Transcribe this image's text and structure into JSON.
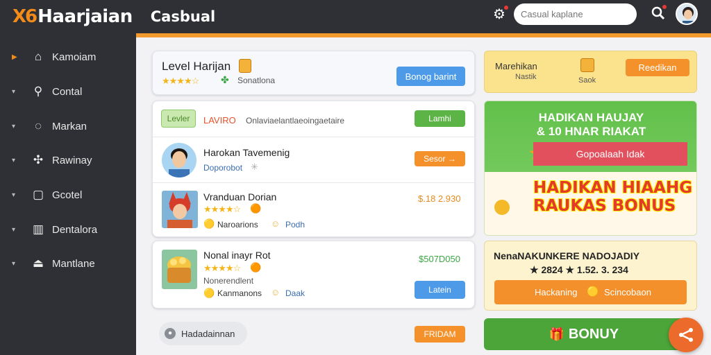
{
  "header": {
    "brand_mark": "X6",
    "brand_name": "Haarjaian",
    "app_title": "Casbual",
    "search_placeholder": "Casual kaplane"
  },
  "sidebar": {
    "items": [
      {
        "label": "Kamoiam",
        "icon": "home-icon"
      },
      {
        "label": "Contal",
        "icon": "search-icon"
      },
      {
        "label": "Markan",
        "icon": "chat-icon"
      },
      {
        "label": "Rawinay",
        "icon": "puzzle-icon"
      },
      {
        "label": "Gcotel",
        "icon": "box-icon"
      },
      {
        "label": "Dentalora",
        "icon": "building-icon"
      },
      {
        "label": "Mantlane",
        "icon": "upload-icon"
      }
    ]
  },
  "level": {
    "title": "Level Harijan",
    "rating_stars": 4.5,
    "subtitle": "Sonatlona",
    "button": "Bonog barint"
  },
  "list": {
    "header": {
      "tag": "Levler",
      "title": "LAVIRO",
      "subtitle": "Onlaviaelantlaeoingaetaire",
      "button": "Lamhi"
    },
    "rows": [
      {
        "title": "Harokan Tavemenig",
        "sub": "Doporobot",
        "button": "Sesor →"
      },
      {
        "title": "Vranduan Dorian",
        "rating_stars": 4.5,
        "meta1": "Naroarions",
        "meta2": "Podh",
        "price": "$.18 2.930"
      }
    ]
  },
  "game": {
    "title": "Nonal inayr Rot",
    "rating_stars": 4.5,
    "sub": "Nonerendlent",
    "meta1": "Kanmanons",
    "meta2": "Daak",
    "price": "$507D050",
    "button": "Latein"
  },
  "footer": {
    "pill_label": "Hadadainnan",
    "button": "FRIDAM"
  },
  "promo_top": {
    "title": "Marehikan",
    "sub": "Nastik",
    "icon_label": "Saok",
    "button": "Reedikan"
  },
  "promo_green": {
    "line1": "HADIKAN HAUJAY",
    "line2": "& 10 HNAR RIAKAT",
    "ribbon": "Gopoalaah Idak",
    "big1": "HADIKAN HIAAHG",
    "big2": "RAUKAS BONUS"
  },
  "promo_cream": {
    "title": "NenaNAKUNKERE NADOJADIY",
    "numbers": "★ 2824 ★ 1.52. 3. 234",
    "button_left": "Hackaning",
    "button_right": "Scincobaon"
  },
  "bonus_button": "BONUY",
  "colors": {
    "accent": "#f29a2e",
    "sidebar_bg": "#2f3035",
    "green": "#5db446",
    "blue": "#4c9ae8"
  }
}
